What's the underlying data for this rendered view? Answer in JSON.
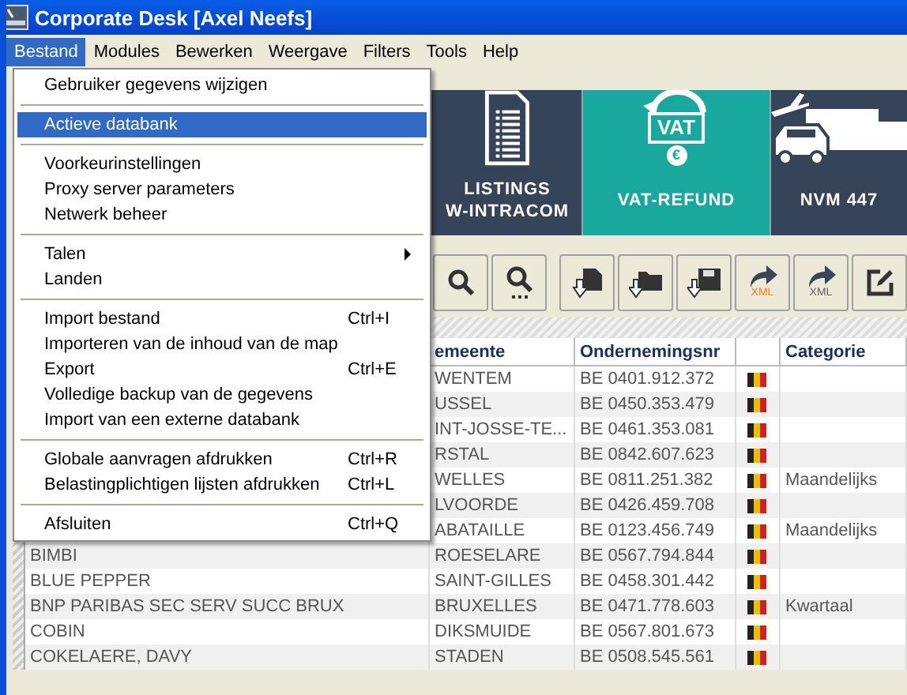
{
  "window": {
    "title": "Corporate Desk  [Axel Neefs]"
  },
  "menubar": [
    {
      "label": "Bestand",
      "selected": true
    },
    {
      "label": "Modules",
      "selected": false
    },
    {
      "label": "Bewerken",
      "selected": false
    },
    {
      "label": "Weergave",
      "selected": false
    },
    {
      "label": "Filters",
      "selected": false
    },
    {
      "label": "Tools",
      "selected": false
    },
    {
      "label": "Help",
      "selected": false
    }
  ],
  "menu": [
    {
      "kind": "item",
      "label": "Gebruiker gegevens wijzigen",
      "selected": false,
      "submenu": false
    },
    {
      "kind": "separator"
    },
    {
      "kind": "item",
      "label": "Actieve databank",
      "selected": true,
      "submenu": false
    },
    {
      "kind": "separator"
    },
    {
      "kind": "item",
      "label": "Voorkeurinstellingen",
      "selected": false,
      "submenu": false
    },
    {
      "kind": "item",
      "label": "Proxy server parameters",
      "selected": false,
      "submenu": false
    },
    {
      "kind": "item",
      "label": "Netwerk beheer",
      "selected": false,
      "submenu": false
    },
    {
      "kind": "separator"
    },
    {
      "kind": "item",
      "label": "Talen",
      "selected": false,
      "submenu": true
    },
    {
      "kind": "item",
      "label": "Landen",
      "selected": false,
      "submenu": false
    },
    {
      "kind": "separator"
    },
    {
      "kind": "item",
      "label": "Import bestand",
      "shortcut": "Ctrl+I",
      "selected": false,
      "submenu": false
    },
    {
      "kind": "item",
      "label": "Importeren van de inhoud van de map",
      "selected": false,
      "submenu": false
    },
    {
      "kind": "item",
      "label": "Export",
      "shortcut": "Ctrl+E",
      "selected": false,
      "submenu": false
    },
    {
      "kind": "item",
      "label": "Volledige backup van de gegevens",
      "selected": false,
      "submenu": false
    },
    {
      "kind": "item",
      "label": "Import van een externe databank",
      "selected": false,
      "submenu": false
    },
    {
      "kind": "separator"
    },
    {
      "kind": "item",
      "label": "Globale aanvragen afdrukken",
      "shortcut": "Ctrl+R",
      "selected": false,
      "submenu": false
    },
    {
      "kind": "item",
      "label": "Belastingplichtigen lijsten afdrukken",
      "shortcut": "Ctrl+L",
      "selected": false,
      "submenu": false
    },
    {
      "kind": "separator"
    },
    {
      "kind": "item",
      "label": "Afsluiten",
      "shortcut": "Ctrl+Q",
      "selected": false,
      "submenu": false
    }
  ],
  "tiles": [
    {
      "kind": "listing",
      "lines": [
        "LISTINGS",
        "W-INTRACOM"
      ],
      "selected": false
    },
    {
      "kind": "vat",
      "lines": [
        "VAT-REFUND"
      ],
      "icon_label": "VAT",
      "icon_sub": "€",
      "selected": true
    },
    {
      "kind": "transport",
      "lines": [
        "NVM 447"
      ],
      "selected": false
    }
  ],
  "toolbar": [
    {
      "kind": "search"
    },
    {
      "kind": "search-more"
    },
    {
      "kind": "gap"
    },
    {
      "kind": "import-file"
    },
    {
      "kind": "import-folder"
    },
    {
      "kind": "import-disk"
    },
    {
      "kind": "export",
      "label": "XML",
      "color": "#f08020"
    },
    {
      "kind": "export",
      "label": "XML",
      "color": "#606060"
    },
    {
      "kind": "edit"
    }
  ],
  "table": {
    "columns": [
      "emeente",
      "Ondernemingsnr",
      "Categorie"
    ],
    "rows": [
      {
        "gemeente": "WENTEM",
        "number": "BE 0401.912.372"
      },
      {
        "gemeente": "USSEL",
        "number": "BE 0450.353.479"
      },
      {
        "gemeente": "INT-JOSSE-TE...",
        "number": "BE 0461.353.081"
      },
      {
        "gemeente": "RSTAL",
        "number": "BE 0842.607.623"
      },
      {
        "gemeente": "WELLES",
        "number": "BE 0811.251.382",
        "category": "Maandelijks"
      },
      {
        "gemeente": "LVOORDE",
        "number": "BE 0426.459.708"
      },
      {
        "gemeente": "ABATAILLE",
        "number": "BE 0123.456.749",
        "category": "Maandelijks"
      },
      {
        "name": "BIMBI",
        "gemeente": "ROESELARE",
        "number": "BE 0567.794.844"
      },
      {
        "name": "BLUE PEPPER",
        "gemeente": "SAINT-GILLES",
        "number": "BE 0458.301.442"
      },
      {
        "name": "BNP PARIBAS SEC SERV SUCC BRUX",
        "gemeente": "BRUXELLES",
        "number": "BE 0471.778.603",
        "category": "Kwartaal"
      },
      {
        "name": "COBIN",
        "gemeente": "DIKSMUIDE",
        "number": "BE 0567.801.673"
      },
      {
        "name": "COKELAERE, DAVY",
        "gemeente": "STADEN",
        "number": "BE 0508.545.561"
      }
    ]
  }
}
